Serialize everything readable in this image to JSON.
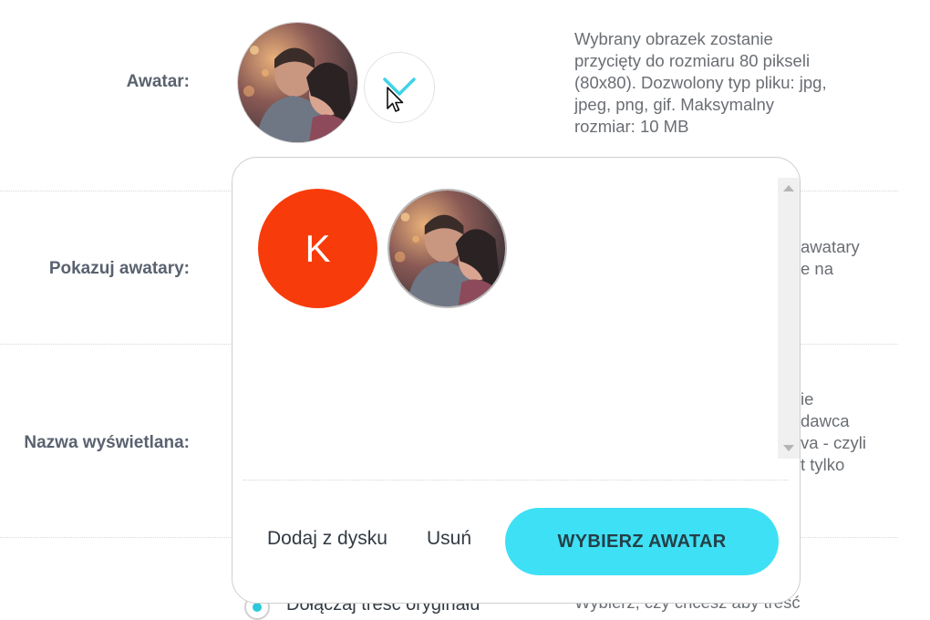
{
  "fields": {
    "avatar_label": "Awatar:",
    "show_avatars_label": "Pokazuj awatary:",
    "display_name_label": "Nazwa wyświetlana:",
    "bottom_label": "..."
  },
  "avatar_description": [
    "Wybrany obrazek zostanie",
    "przycięty do rozmiaru 80 pikseli",
    "(80x80). Dozwolony typ pliku: jpg,",
    "jpeg, png, gif. Maksymalny",
    "rozmiar: 10 MB"
  ],
  "show_avatars_desc_partial": [
    "awatary",
    "e na"
  ],
  "display_name_desc_partial": [
    "ie",
    "dawca",
    "va - czyli",
    "t tylko"
  ],
  "bottom_option": {
    "label": "Dołączaj treść oryginału",
    "desc": "Wybierz, czy chcesz aby treść"
  },
  "popup": {
    "letter_avatar": "K",
    "letter_avatar_color": "#f83b0a",
    "add_from_disk": "Dodaj z dysku",
    "remove": "Usuń",
    "choose_button": "WYBIERZ AWATAR",
    "accent_color": "#3ee0f5"
  },
  "icons": {
    "dropdown": "chevron-down-icon",
    "pointer": "mouse-pointer-icon"
  }
}
